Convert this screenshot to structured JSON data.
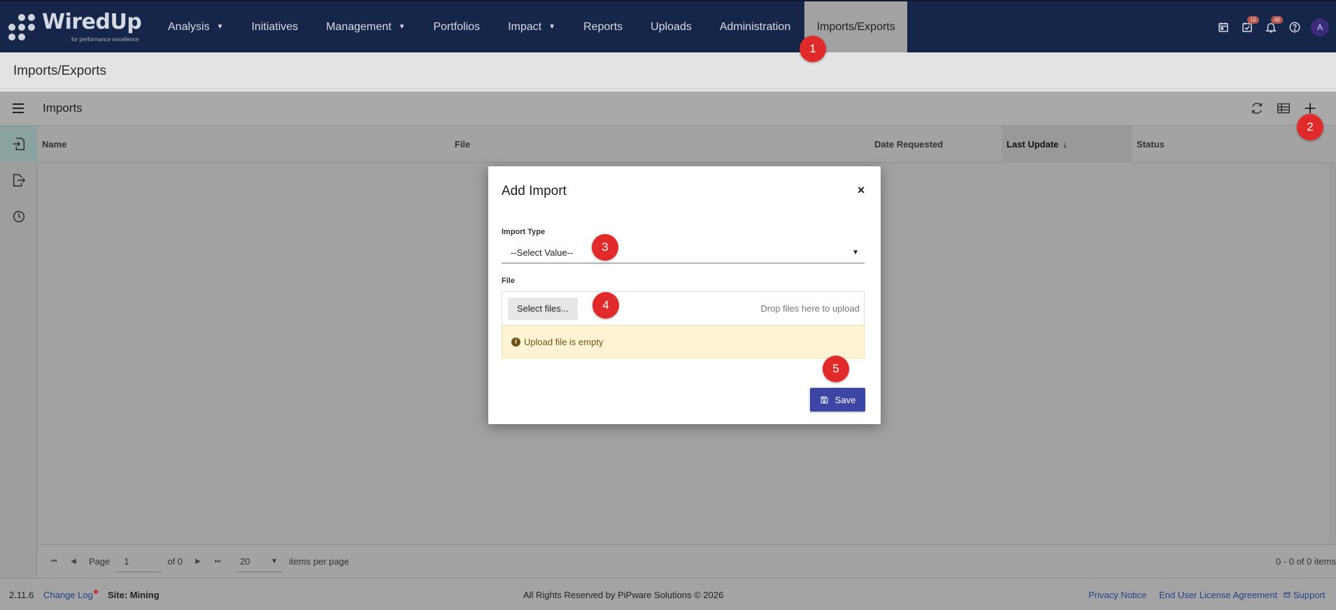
{
  "app": {
    "logo_text": "WiredUp",
    "logo_tagline": "for performance excellence"
  },
  "nav": {
    "items": [
      {
        "label": "Analysis",
        "caret": "▼"
      },
      {
        "label": "Initiatives",
        "caret": ""
      },
      {
        "label": "Management",
        "caret": "▼"
      },
      {
        "label": "Portfolios",
        "caret": ""
      },
      {
        "label": "Impact",
        "caret": "▼"
      },
      {
        "label": "Reports",
        "caret": ""
      },
      {
        "label": "Uploads",
        "caret": ""
      },
      {
        "label": "Administration",
        "caret": ""
      },
      {
        "label": "Imports/Exports",
        "caret": ""
      }
    ],
    "active": "Imports/Exports",
    "icons": [
      "calendar-icon",
      "task-check-icon",
      "bell-icon",
      "help-icon"
    ],
    "tasks_badge": "10",
    "notifications_badge": "48",
    "avatar_initial": "A"
  },
  "page": {
    "title": "Imports/Exports"
  },
  "toolbar": {
    "title": "Imports"
  },
  "grid": {
    "columns": [
      {
        "label": "Name",
        "sorted": false,
        "sort_indicator": ""
      },
      {
        "label": "File",
        "sorted": false,
        "sort_indicator": ""
      },
      {
        "label": "Date Requested",
        "sorted": false,
        "sort_indicator": ""
      },
      {
        "label": "Last Update",
        "sorted": true,
        "sort_indicator": "↓"
      },
      {
        "label": "Status",
        "sorted": false,
        "sort_indicator": ""
      }
    ],
    "rows": []
  },
  "pager": {
    "page_label": "Page",
    "page_value": "1",
    "of_label": "of 0",
    "page_size": "20",
    "items_per_page_label": "items per page",
    "summary": "0 - 0 of 0 items"
  },
  "footer": {
    "version": "2.11.6",
    "changelog": "Change Log",
    "site": "Site: Mining",
    "copyright": "All Rights Reserved by PiPware Solutions © 2026",
    "privacy": "Privacy Notice",
    "eula": "End User License Agreement",
    "support": "Support"
  },
  "modal": {
    "title": "Add Import",
    "close_label": "×",
    "import_type_label": "Import Type",
    "import_type_value": "--Select Value--",
    "file_label": "File",
    "select_files_label": "Select files...",
    "drop_hint": "Drop files here to upload",
    "warning": "Upload file is empty",
    "save_label": "Save"
  },
  "markers": [
    "1",
    "2",
    "3",
    "4",
    "5"
  ],
  "colors": {
    "nav_bg": "#16254a",
    "primary_button": "#3c47a5",
    "marker": "#e12b2b",
    "warning_bg": "#fff3d3"
  }
}
